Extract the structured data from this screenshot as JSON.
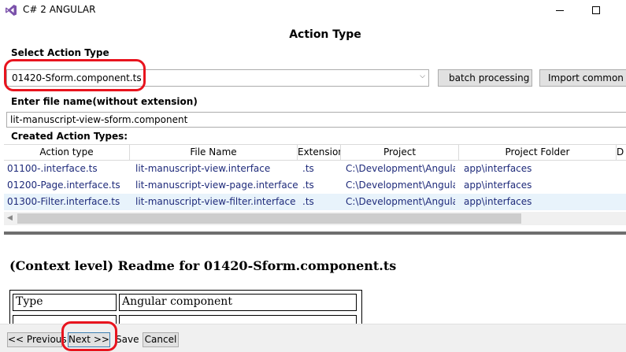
{
  "window": {
    "title": "C# 2 ANGULAR"
  },
  "heading": "Action Type",
  "select_action": {
    "label": "Select Action Type",
    "value": "01420-Sform.component.ts"
  },
  "buttons": {
    "batch": "batch processing",
    "import": "Import common st"
  },
  "file_name": {
    "label": "Enter file name(without extension)",
    "value": "lit-manuscript-view-sform.component"
  },
  "created": {
    "label": "Created Action Types:",
    "columns": [
      "Action type",
      "File Name",
      "Extension",
      "Project",
      "Project Folder",
      "D"
    ],
    "rows": [
      {
        "action_type": "01100-.interface.ts",
        "file_name": "lit-manuscript-view.interface",
        "extension": ".ts",
        "project": "C:\\Development\\AngularD",
        "folder": "app\\interfaces"
      },
      {
        "action_type": "01200-Page.interface.ts",
        "file_name": "lit-manuscript-view-page.interface",
        "extension": ".ts",
        "project": "C:\\Development\\AngularD",
        "folder": "app\\interfaces"
      },
      {
        "action_type": "01300-Filter.interface.ts",
        "file_name": "lit-manuscript-view-filter.interface",
        "extension": ".ts",
        "project": "C:\\Development\\AngularD",
        "folder": "app\\interfaces"
      }
    ]
  },
  "readme": {
    "title": "(Context level) Readme for 01420-Sform.component.ts",
    "table": [
      {
        "key": "Type",
        "value": "Angular component"
      }
    ]
  },
  "bottom": {
    "prev": "<< Previous",
    "next": "Next >>",
    "save": "Save",
    "cancel": "Cancel"
  },
  "colors": {
    "annotation": "#e8141e",
    "selected_row": "#e8f3fb",
    "cell_text": "#1e2a7a"
  }
}
